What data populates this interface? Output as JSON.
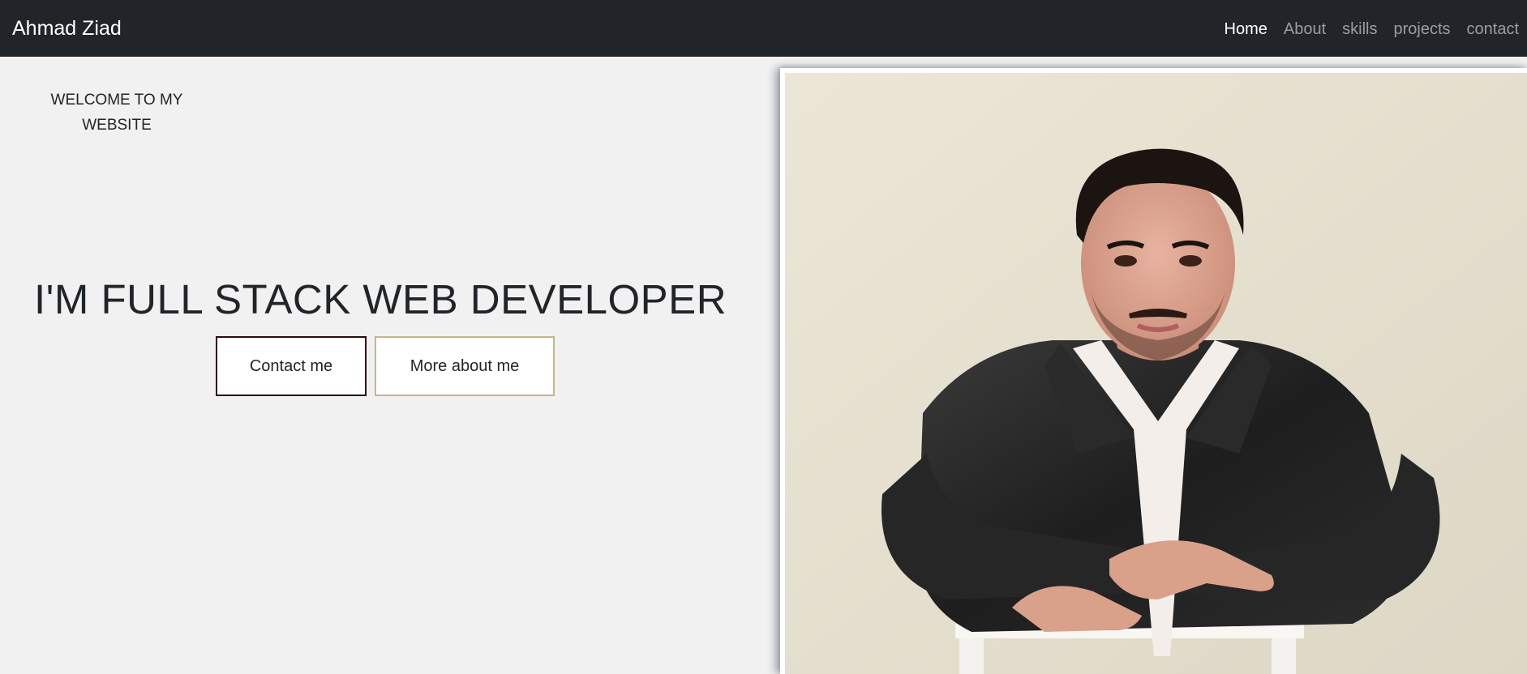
{
  "navbar": {
    "brand": "Ahmad Ziad",
    "links": [
      {
        "label": "Home",
        "active": true
      },
      {
        "label": "About",
        "active": false
      },
      {
        "label": "skills",
        "active": false
      },
      {
        "label": "projects",
        "active": false
      },
      {
        "label": "contact",
        "active": false
      }
    ]
  },
  "hero": {
    "welcome": "WELCOME TO MY WEBSITE",
    "headline": "I'M FULL STACK WEB DEVELOPER",
    "buttons": {
      "contact": "Contact me",
      "more": "More about me"
    }
  },
  "colors": {
    "navbar_bg": "#212529",
    "page_bg": "#f1f1f1",
    "contact_border": "#2a0a0a",
    "more_border": "#c8b48a"
  },
  "photo": {
    "alt": "portrait-photo"
  }
}
